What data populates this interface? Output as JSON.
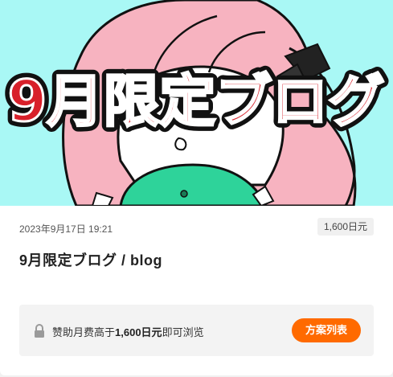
{
  "thumbnail": {
    "title_text": "9月限定ブログ",
    "bg_color": "#a9f8f5",
    "title_color": "#d8202a"
  },
  "post": {
    "date": "2023年9月17日 19:21",
    "price_badge": "1,600日元",
    "title": "9月限定ブログ / blog"
  },
  "lock_notice": {
    "prefix": "赞助月费高于",
    "amount": "1,600日元",
    "suffix": "即可浏览",
    "button_label": "方案列表",
    "accent": "#ff6a00"
  }
}
